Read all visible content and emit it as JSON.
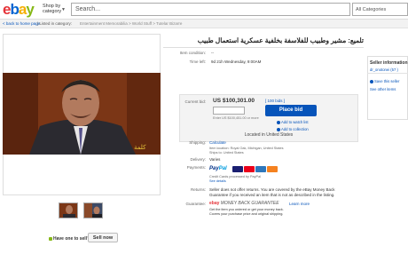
{
  "header": {
    "logo_letters": [
      "e",
      "b",
      "a",
      "y"
    ],
    "shop_by_line1": "Shop by",
    "shop_by_line2": "category",
    "search_placeholder": "Search...",
    "categories_select": "All Categories"
  },
  "subbar": {
    "back_link": "< back to home page",
    "listed_in": "| Listed in category:",
    "breadcrumbs": "Entertainment Memorabilia > World Stuff > Tutelar Bizarre"
  },
  "listing": {
    "title": "تلميع: مشير وطبيب للفلاسفة بخلفية عسكرية استعمال طبيب",
    "condition_label": "Item condition:",
    "condition_value": "--",
    "time_left_label": "Time left:",
    "time_left_value": "9d 21h Wednesday, 9:00AM",
    "current_bid_label": "Current bid:",
    "current_bid_value": "US $100,301.00",
    "bids_link": "[ 100 bids ]",
    "place_bid_button": "Place bid",
    "enter_amount_hint": "Enter US $100,451.00 or more",
    "add_to_watch": "Add to watch list",
    "add_to_collection": "Add to collection",
    "located_in": "Located in United States"
  },
  "shipping": {
    "shipping_label": "Shipping:",
    "shipping_value": "Calculate",
    "item_location": "Item location: Royal Oak, Michigan, United States",
    "ships_to": "Ships to: United States",
    "delivery_label": "Delivery:",
    "delivery_value": "Varies",
    "payments_label": "Payments:",
    "paypal_pay": "Pay",
    "paypal_pal": "Pal",
    "credit_cards_note": "Credit Cards processed by PayPal",
    "see_details": "See details",
    "card_colors": [
      "#1a1f71",
      "#eb001b",
      "#2e77bb",
      "#f58220"
    ]
  },
  "returns": {
    "returns_label": "Returns:",
    "returns_text_line1": "Seller does not offer returns. You are covered by the eBay Money Back",
    "returns_text_line2": "Guarantee if you received an item that is not as described in the listing."
  },
  "guarantee": {
    "guarantee_label": "Guarantee:",
    "mbg_logo_e": "ebay",
    "mbg_logo_text": "MONEY BACK GUARANTEE",
    "learn_more": "Learn more",
    "guarantee_line1": "Get the item you ordered or get your money back.",
    "guarantee_line2": "Covers your purchase price and original shipping."
  },
  "seller": {
    "title": "Seller information",
    "name": "dr_onotonei (57 )",
    "save_seller": "Save this seller",
    "other_items": "See other items"
  },
  "sell_promo": {
    "have_one": "Have one to sell?",
    "sell_now": "Sell now"
  },
  "photo": {
    "caption_mark": "كلمة"
  }
}
